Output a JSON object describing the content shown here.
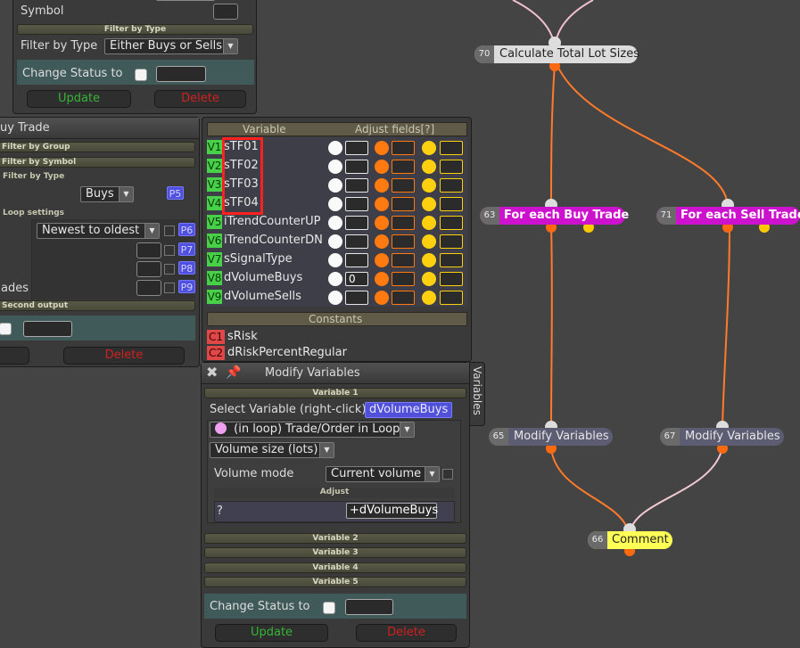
{
  "panel_top": {
    "symbol_label": "Symbol",
    "section_filter_by_type": "Filter by Type",
    "filter_by_type_label": "Filter by Type",
    "filter_by_type_value": "Either Buys or Sells",
    "change_status_label": "Change Status to",
    "update_label": "Update",
    "delete_label": "Delete"
  },
  "panel_buy": {
    "title": "uy Trade",
    "section_group": "Filter by Group",
    "section_symbol": "Filter by Symbol",
    "section_type": "Filter by Type",
    "type_value": "Buys",
    "p5": "P5",
    "section_loop": "Loop settings",
    "loop_order_value": "Newest to oldest",
    "p6": "P6",
    "p7": "P7",
    "p8": "P8",
    "p9": "P9",
    "trades_label": "ades",
    "section_second_output": "Second output",
    "delete_label": "Delete"
  },
  "variables_panel": {
    "header_variable": "Variable",
    "header_adjust": "Adjust fields[?]",
    "variables": [
      {
        "badge": "V1",
        "name": "sTF01",
        "field1": "",
        "field2": "",
        "field3": ""
      },
      {
        "badge": "V2",
        "name": "sTF02",
        "field1": "",
        "field2": "",
        "field3": ""
      },
      {
        "badge": "V3",
        "name": "sTF03",
        "field1": "",
        "field2": "",
        "field3": ""
      },
      {
        "badge": "V4",
        "name": "sTF04",
        "field1": "",
        "field2": "",
        "field3": ""
      },
      {
        "badge": "V5",
        "name": "iTrendCounterUP",
        "field1": "",
        "field2": "",
        "field3": ""
      },
      {
        "badge": "V6",
        "name": "iTrendCounterDN",
        "field1": "",
        "field2": "",
        "field3": ""
      },
      {
        "badge": "V7",
        "name": "sSignalType",
        "field1": "",
        "field2": "",
        "field3": ""
      },
      {
        "badge": "V8",
        "name": "dVolumeBuys",
        "field1": "0",
        "field2": "",
        "field3": ""
      },
      {
        "badge": "V9",
        "name": "dVolumeSells",
        "field1": "",
        "field2": "",
        "field3": ""
      }
    ],
    "constants_header": "Constants",
    "constants": [
      {
        "badge": "C1",
        "name": "sRisk"
      },
      {
        "badge": "C2",
        "name": "dRiskPercentRegular"
      }
    ],
    "side_tab": "Variables"
  },
  "modify_panel": {
    "title": "Modify Variables",
    "section_var1": "Variable 1",
    "select_label": "Select Variable (right-click)",
    "selected_variable": "dVolumeBuys",
    "source_value": "(in loop) Trade/Order in Loop",
    "property_value": "Volume size (lots)",
    "volume_mode_label": "Volume mode",
    "volume_mode_value": "Current volume",
    "adjust_header": "Adjust",
    "adjust_help": "?",
    "adjust_value": "+dVolumeBuys",
    "section_var2": "Variable 2",
    "section_var3": "Variable 3",
    "section_var4": "Variable 4",
    "section_var5": "Variable 5",
    "change_status_label": "Change Status to",
    "update_label": "Update",
    "delete_label": "Delete"
  },
  "graph_nodes": {
    "n70": {
      "num": "70",
      "label": "Calculate Total Lot Sizes"
    },
    "n63": {
      "num": "63",
      "label": "For each Buy Trade"
    },
    "n71": {
      "num": "71",
      "label": "For each Sell Trade"
    },
    "n65": {
      "num": "65",
      "label": "Modify Variables"
    },
    "n67": {
      "num": "67",
      "label": "Modify Variables"
    },
    "n66": {
      "num": "66",
      "label": "Comment"
    }
  },
  "colors": {
    "background": "#444444",
    "wire_white": "#f0c8d0",
    "wire_orange": "#ff7a2a",
    "for_each_node": "#cc12cc",
    "comment_node": "#ffff55",
    "highlight_box": "#ff2020"
  }
}
